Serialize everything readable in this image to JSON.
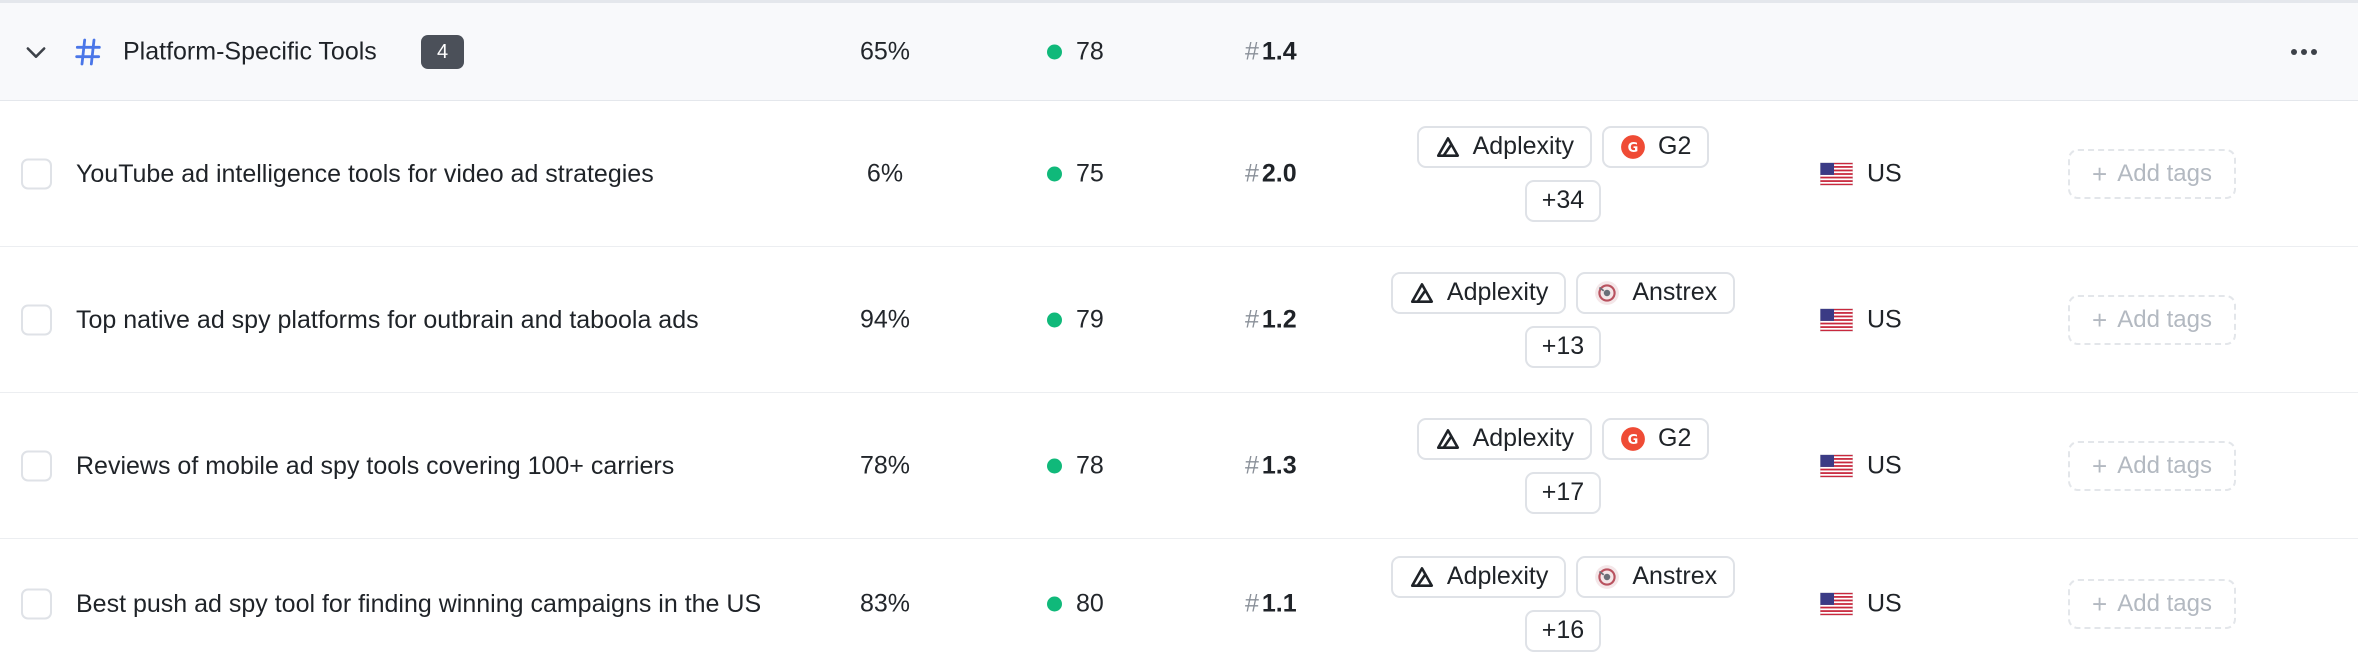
{
  "group": {
    "title": "Platform-Specific Tools",
    "count": "4",
    "percent": "65%",
    "score": "78",
    "position": "1.4"
  },
  "colors": {
    "score_dot": "#10b97a",
    "hash_icon": "#4a76e8",
    "badge_bg": "#4b5059",
    "g2_icon": "#ef4b35"
  },
  "rows": [
    {
      "query": "YouTube ad intelligence tools for video ad strategies",
      "percent": "6%",
      "score": "75",
      "position": "2.0",
      "sources": [
        {
          "name": "Adplexity",
          "icon": "adplexity-icon"
        },
        {
          "name": "G2",
          "icon": "g2-icon"
        }
      ],
      "more": "+34",
      "country": "US",
      "add_tags": "Add tags"
    },
    {
      "query": "Top native ad spy platforms for outbrain and taboola ads",
      "percent": "94%",
      "score": "79",
      "position": "1.2",
      "sources": [
        {
          "name": "Adplexity",
          "icon": "adplexity-icon"
        },
        {
          "name": "Anstrex",
          "icon": "anstrex-icon"
        }
      ],
      "more": "+13",
      "country": "US",
      "add_tags": "Add tags"
    },
    {
      "query": "Reviews of mobile ad spy tools covering 100+ carriers",
      "percent": "78%",
      "score": "78",
      "position": "1.3",
      "sources": [
        {
          "name": "Adplexity",
          "icon": "adplexity-icon"
        },
        {
          "name": "G2",
          "icon": "g2-icon"
        }
      ],
      "more": "+17",
      "country": "US",
      "add_tags": "Add tags"
    },
    {
      "query": "Best push ad spy tool for finding winning campaigns in the US",
      "percent": "83%",
      "score": "80",
      "position": "1.1",
      "sources": [
        {
          "name": "Adplexity",
          "icon": "adplexity-icon"
        },
        {
          "name": "Anstrex",
          "icon": "anstrex-icon"
        }
      ],
      "more": "+16",
      "country": "US",
      "add_tags": "Add tags"
    }
  ]
}
